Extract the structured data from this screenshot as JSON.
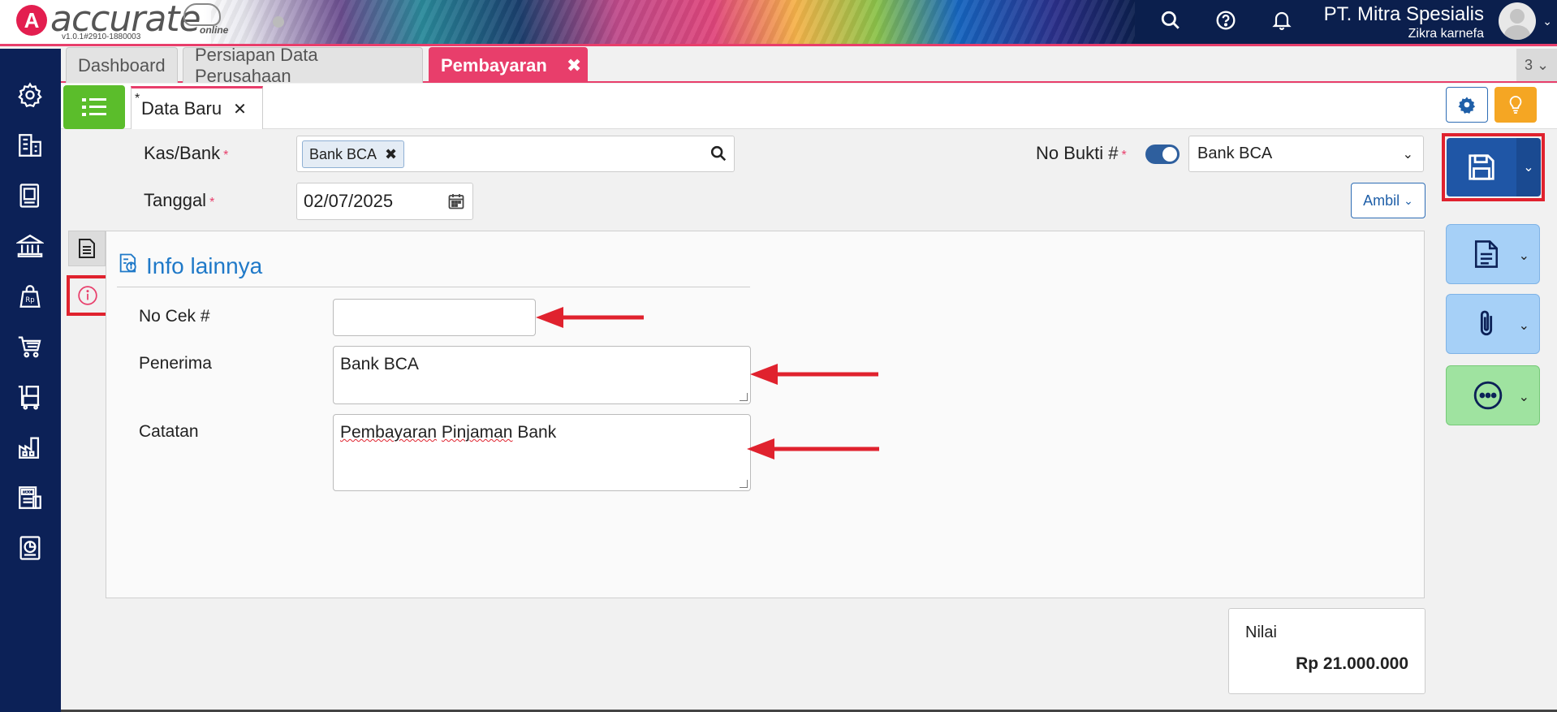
{
  "header": {
    "logo_letter": "A",
    "logo_text": "accurate",
    "logo_sub": "online",
    "version": "v1.0.1#2910-1880003",
    "company_name": "PT. Mitra Spesialis",
    "user_name": "Zikra karnefa"
  },
  "tabs": [
    {
      "label": "Dashboard"
    },
    {
      "label": "Persiapan Data Perusahaan"
    },
    {
      "label": "Pembayaran"
    }
  ],
  "tab_count": "3",
  "doc_tab": {
    "star": "*",
    "label": "Data Baru"
  },
  "form": {
    "kas_label": "Kas/Bank",
    "kas_value": "Bank BCA",
    "tanggal_label": "Tanggal",
    "tanggal_value": "02/07/2025",
    "bukti_label": "No Bukti #",
    "bukti_value": "Bank BCA",
    "ambil_label": "Ambil",
    "required_mark": "*"
  },
  "info": {
    "title": "Info lainnya",
    "cek_label": "No Cek #",
    "cek_value": "",
    "penerima_label": "Penerima",
    "penerima_value": "Bank BCA",
    "catatan_label": "Catatan",
    "catatan_value_1": "Pembayaran",
    "catatan_value_2": "Pinjaman",
    "catatan_value_3": "Bank"
  },
  "nilai": {
    "label": "Nilai",
    "value": "Rp 21.000.000"
  },
  "colors": {
    "accent": "#e83e6b",
    "primary": "#1f56a6",
    "sidebar": "#0c2157",
    "highlight": "#e0222e"
  }
}
